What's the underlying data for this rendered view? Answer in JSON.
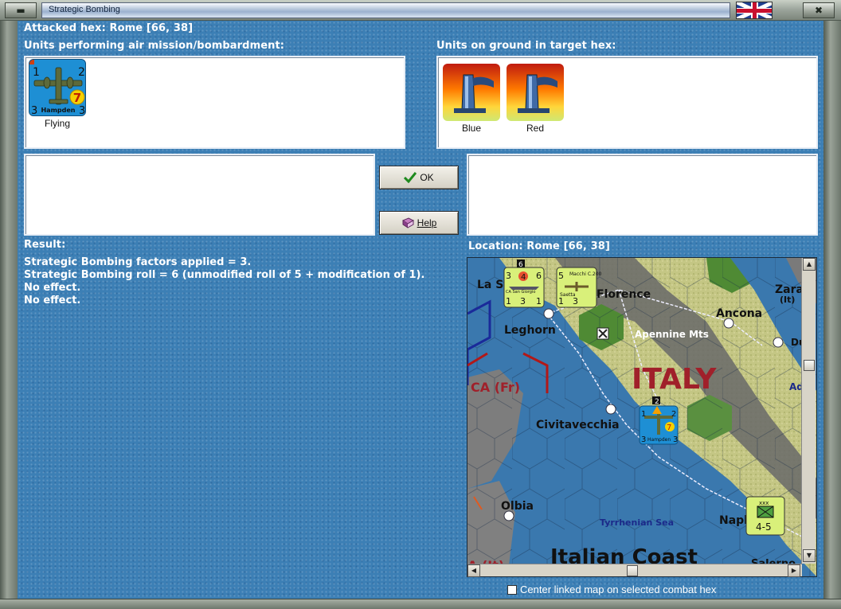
{
  "window": {
    "title": "Strategic Bombing",
    "min_glyph": "▬",
    "close_glyph": "✖"
  },
  "attacked_hex": "Attacked hex: Rome  [66, 38]",
  "air_units_label": "Units performing air mission/bombardment:",
  "ground_units_label": "Units on ground in target hex:",
  "air_units": [
    {
      "caption": "Flying",
      "name": "Hampden",
      "tl": "1",
      "tr": "2",
      "bl": "3",
      "br": "3",
      "badge": "7"
    }
  ],
  "ground_units": [
    {
      "caption": "Blue"
    },
    {
      "caption": "Red"
    }
  ],
  "buttons": {
    "ok": "OK",
    "help": "Help"
  },
  "result": {
    "label": "Result:",
    "lines": [
      "Strategic Bombing factors applied = 3.",
      "Strategic Bombing roll = 6 (unmodified roll of 5 + modification of 1).",
      "No effect.",
      "No effect."
    ]
  },
  "location_label": "Location:  Rome  [66, 38]",
  "map": {
    "labels": {
      "la_spezia": "La S",
      "florence": "Florence",
      "zara": "Zara",
      "zara_it": "(It)",
      "ancona": "Ancona",
      "leghorn": "Leghorn",
      "apennine": "Apennine Mts",
      "italy": "ITALY",
      "du": "Du",
      "ad": "Ad",
      "corsica": "CA (Fr)",
      "civitavecchia": "Civitavecchia",
      "olbia": "Olbia",
      "tyrrhenian": "Tyrrhenian Sea",
      "napl": "Napl",
      "italian_coast": "Italian Coast",
      "salerno": "Salerno",
      "sardinia_it": "A (It)"
    },
    "units": {
      "naval": {
        "tl": "3",
        "badge": "4",
        "tr": "6",
        "name": "CA San Giorgio",
        "bl": "1",
        "bm": "3",
        "br": "1",
        "top": "6"
      },
      "air": {
        "tl": "5",
        "name": "Macchi C.200",
        "sub": "Saetta",
        "bl": "1",
        "br": "3"
      },
      "bomber": {
        "tl": "1",
        "tr": "2",
        "bl": "3",
        "br": "3",
        "badge": "7",
        "name": "Hampden",
        "top": "2"
      },
      "corps": {
        "top": "xxx",
        "value": "4-5",
        "side": "Italian"
      }
    }
  },
  "center_map_label": "Center linked map on selected combat hex",
  "colors": {
    "background": "#3c7fb5",
    "sea": "#3a78ae",
    "land": "#c9c98a",
    "mountain": "#5a5a5a",
    "forest": "#5d8a3a",
    "italy_label": "#a0202a",
    "counter_air": "#1e90d6",
    "counter_italian": "#d9f07a"
  }
}
